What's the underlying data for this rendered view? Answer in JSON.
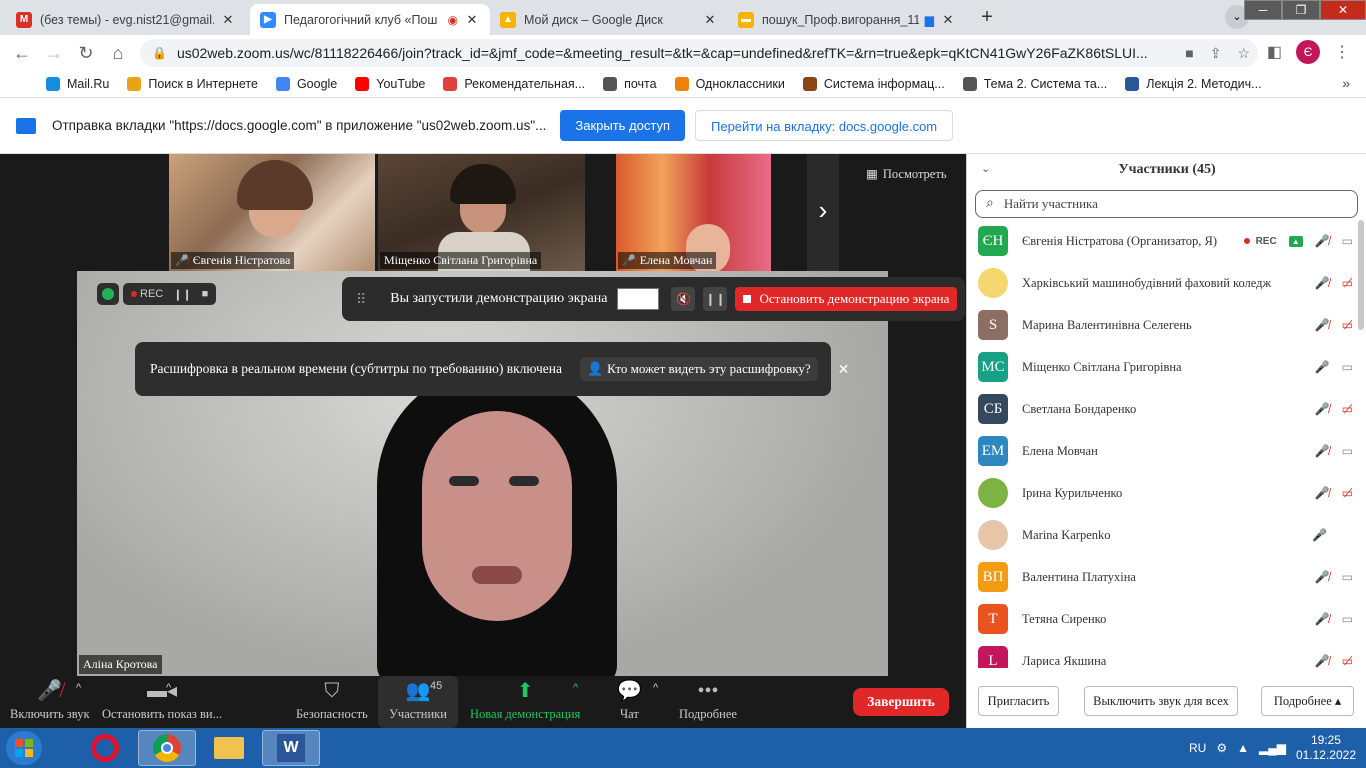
{
  "browser": {
    "tabs": [
      {
        "label": "(без темы) - evg.nist21@gmail.cc",
        "icon": "gmail-icon",
        "color": "#d93025",
        "glyph": "M"
      },
      {
        "label": "Педагогогічний клуб «Пош",
        "icon": "zoom-icon",
        "color": "#2d8cff",
        "glyph": "▶"
      },
      {
        "label": "Мой диск – Google Диск",
        "icon": "google-drive-icon",
        "color": "#f4b400",
        "glyph": "▲"
      },
      {
        "label": "пошук_Проф.вигорання_11",
        "icon": "google-slides-icon",
        "color": "#f4b400",
        "glyph": "▬"
      }
    ],
    "url": "us02web.zoom.us/wc/81118226466/join?track_id=&jmf_code=&meeting_result=&tk=&cap=undefined&refTK=&rn=true&epk=qKtCN41GwY26FaZK86tSLUI...",
    "profile_initial": "Є",
    "bookmarks": [
      {
        "label": "Mail.Ru",
        "color": "#168de2"
      },
      {
        "label": "Поиск в Интернете",
        "color": "#e8a317"
      },
      {
        "label": "Google",
        "color": "#4285f4"
      },
      {
        "label": "YouTube",
        "color": "#ff0000"
      },
      {
        "label": "Рекомендательная...",
        "color": "#e0413b"
      },
      {
        "label": "почта",
        "color": "#555555"
      },
      {
        "label": "Одноклассники",
        "color": "#ee8208"
      },
      {
        "label": "Система інформац...",
        "color": "#8b4513"
      },
      {
        "label": "Тема 2. Система та...",
        "color": "#555555"
      },
      {
        "label": "Лекція 2. Методич...",
        "color": "#2b5797"
      }
    ],
    "bookmarks_more": "»",
    "infobar": {
      "message": "Отправка вкладки \"https://docs.google.com\" в приложение \"us02web.zoom.us\"...",
      "close_access": "Закрыть доступ",
      "go_to_tab": "Перейти на вкладку: docs.google.com"
    }
  },
  "meeting": {
    "thumbnails": [
      {
        "name": "Євгенія Ністратова",
        "muted": true
      },
      {
        "name": "Міщенко Світлана Григорівна",
        "muted": false
      },
      {
        "name": "Елена Мовчан",
        "muted": true
      }
    ],
    "view_button": "Посмотреть",
    "rec_label": "REC",
    "share_bar": {
      "text": "Вы запустили демонстрацию экрана",
      "stop": "Остановить демонстрацию экрана"
    },
    "caption_banner": {
      "text": "Расшифровка в реальном времени (субтитры по требованию) включена",
      "button": "Кто может видеть эту расшифровку?"
    },
    "speaker_name": "Аліна Кротова",
    "controls": {
      "unmute": "Включить звук",
      "stop_video": "Остановить показ ви...",
      "security": "Безопасность",
      "participants": "Участники",
      "participants_count": "45",
      "new_share": "Новая демонстрация",
      "chat": "Чат",
      "more": "Подробнее",
      "end": "Завершить"
    }
  },
  "participants_panel": {
    "title": "Участники (45)",
    "search_placeholder": "Найти участника",
    "rec_label": "REC",
    "participants": [
      {
        "name": "Євгенія Ністратова (Организатор, Я)",
        "initials": "ЄН",
        "color": "#22a94f",
        "mic": "off",
        "cam": "on",
        "host": true
      },
      {
        "name": "Харківський машинобудівний фаховий коледж",
        "initials": "",
        "color": "#f5d76e",
        "mic": "off",
        "cam": "off",
        "photo": true
      },
      {
        "name": "Марина Валентинівна Селегень",
        "initials": "S",
        "color": "#8d6e63",
        "mic": "off",
        "cam": "off"
      },
      {
        "name": "Міщенко Світлана Григорівна",
        "initials": "МС",
        "color": "#16a085",
        "mic": "on",
        "cam": "on"
      },
      {
        "name": "Светлана Бондаренко",
        "initials": "СБ",
        "color": "#34495e",
        "mic": "off",
        "cam": "off"
      },
      {
        "name": "Елена Мовчан",
        "initials": "ЕМ",
        "color": "#2e86c1",
        "mic": "off",
        "cam": "on"
      },
      {
        "name": "Ірина Курильченко",
        "initials": "",
        "color": "#7cb342",
        "mic": "off",
        "cam": "off",
        "photo": true
      },
      {
        "name": "Marina Karpenko",
        "initials": "",
        "color": "#e8c4a8",
        "mic": "on",
        "cam": "none",
        "photo": true
      },
      {
        "name": "Валентина Платухіна",
        "initials": "ВП",
        "color": "#f39c12",
        "mic": "off",
        "cam": "on"
      },
      {
        "name": "Тетяна Сиренко",
        "initials": "T",
        "color": "#e8531f",
        "mic": "off",
        "cam": "on"
      },
      {
        "name": "Лариса Якшина",
        "initials": "L",
        "color": "#c2185b",
        "mic": "off",
        "cam": "off"
      }
    ],
    "invite": "Пригласить",
    "mute_all": "Выключить звук для всех",
    "more": "Подробнее"
  },
  "taskbar": {
    "lang": "RU",
    "time": "19:25",
    "date": "01.12.2022"
  }
}
